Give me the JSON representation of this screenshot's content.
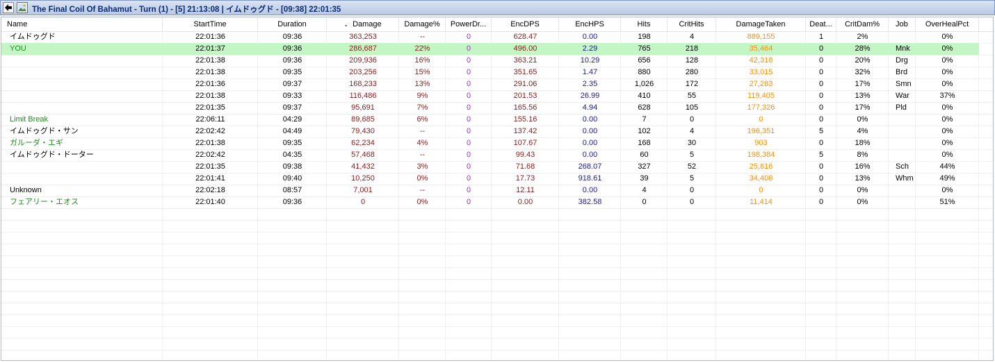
{
  "window": {
    "title": "The Final Coil Of Bahamut - Turn (1) - [5] 21:13:08 | イムドゥグド - [09:38] 22:01:35"
  },
  "colors": {
    "damage": "#8b1a1a",
    "damage_pct": "#8b1a1a",
    "power": "#9932cc",
    "encdps": "#8b1a1a",
    "enchps": "#1a1a8b",
    "damage_taken": "#ff8c00",
    "highlight_row": "#c4f5c4",
    "name_green": "#228b22",
    "name_default": "#000000"
  },
  "table": {
    "sort_indicator": "⌄",
    "columns": [
      "Name",
      "StartTime",
      "Duration",
      "Damage",
      "Damage%",
      "PowerDr...",
      "EncDPS",
      "EncHPS",
      "Hits",
      "CritHits",
      "DamageTaken",
      "Deat...",
      "CritDam%",
      "Job",
      "OverHealPct"
    ],
    "rows": [
      {
        "name": "イムドゥグド",
        "name_color": "black",
        "highlight": false,
        "start": "22:01:36",
        "duration": "09:36",
        "damage": "363,253",
        "damage_pct": "--",
        "power": "0",
        "encdps": "628.47",
        "enchps": "0.00",
        "hits": "198",
        "crit": "4",
        "taken": "889,155",
        "deaths": "1",
        "critdam": "2%",
        "job": "",
        "overheal": "0%"
      },
      {
        "name": "YOU",
        "name_color": "green",
        "highlight": true,
        "start": "22:01:37",
        "duration": "09:36",
        "damage": "286,687",
        "damage_pct": "22%",
        "power": "0",
        "encdps": "496.00",
        "enchps": "2.29",
        "hits": "765",
        "crit": "218",
        "taken": "35,464",
        "deaths": "0",
        "critdam": "28%",
        "job": "Mnk",
        "overheal": "0%"
      },
      {
        "name": "",
        "name_color": "black",
        "highlight": false,
        "start": "22:01:38",
        "duration": "09:36",
        "damage": "209,936",
        "damage_pct": "16%",
        "power": "0",
        "encdps": "363.21",
        "enchps": "10.29",
        "hits": "656",
        "crit": "128",
        "taken": "42,318",
        "deaths": "0",
        "critdam": "20%",
        "job": "Drg",
        "overheal": "0%"
      },
      {
        "name": "",
        "name_color": "black",
        "highlight": false,
        "start": "22:01:38",
        "duration": "09:35",
        "damage": "203,256",
        "damage_pct": "15%",
        "power": "0",
        "encdps": "351.65",
        "enchps": "1.47",
        "hits": "880",
        "crit": "280",
        "taken": "33,015",
        "deaths": "0",
        "critdam": "32%",
        "job": "Brd",
        "overheal": "0%"
      },
      {
        "name": "",
        "name_color": "black",
        "highlight": false,
        "start": "22:01:36",
        "duration": "09:37",
        "damage": "168,233",
        "damage_pct": "13%",
        "power": "0",
        "encdps": "291.06",
        "enchps": "2.35",
        "hits": "1,026",
        "crit": "172",
        "taken": "27,283",
        "deaths": "0",
        "critdam": "17%",
        "job": "Smn",
        "overheal": "0%"
      },
      {
        "name": "",
        "name_color": "black",
        "highlight": false,
        "start": "22:01:38",
        "duration": "09:33",
        "damage": "116,486",
        "damage_pct": "9%",
        "power": "0",
        "encdps": "201.53",
        "enchps": "26.99",
        "hits": "410",
        "crit": "55",
        "taken": "119,405",
        "deaths": "0",
        "critdam": "13%",
        "job": "War",
        "overheal": "37%"
      },
      {
        "name": "",
        "name_color": "black",
        "highlight": false,
        "start": "22:01:35",
        "duration": "09:37",
        "damage": "95,691",
        "damage_pct": "7%",
        "power": "0",
        "encdps": "165.56",
        "enchps": "4.94",
        "hits": "628",
        "crit": "105",
        "taken": "177,326",
        "deaths": "0",
        "critdam": "17%",
        "job": "Pld",
        "overheal": "0%"
      },
      {
        "name": "Limit Break",
        "name_color": "green",
        "highlight": false,
        "start": "22:06:11",
        "duration": "04:29",
        "damage": "89,685",
        "damage_pct": "6%",
        "power": "0",
        "encdps": "155.16",
        "enchps": "0.00",
        "hits": "7",
        "crit": "0",
        "taken": "0",
        "deaths": "0",
        "critdam": "0%",
        "job": "",
        "overheal": "0%"
      },
      {
        "name": "イムドゥグド・サン",
        "name_color": "black",
        "highlight": false,
        "start": "22:02:42",
        "duration": "04:49",
        "damage": "79,430",
        "damage_pct": "--",
        "power": "0",
        "encdps": "137.42",
        "enchps": "0.00",
        "hits": "102",
        "crit": "4",
        "taken": "196,351",
        "deaths": "5",
        "critdam": "4%",
        "job": "",
        "overheal": "0%"
      },
      {
        "name": "ガルーダ・エギ",
        "name_color": "green",
        "highlight": false,
        "start": "22:01:38",
        "duration": "09:35",
        "damage": "62,234",
        "damage_pct": "4%",
        "power": "0",
        "encdps": "107.67",
        "enchps": "0.00",
        "hits": "168",
        "crit": "30",
        "taken": "903",
        "deaths": "0",
        "critdam": "18%",
        "job": "",
        "overheal": "0%"
      },
      {
        "name": "イムドゥグド・ドーター",
        "name_color": "black",
        "highlight": false,
        "start": "22:02:42",
        "duration": "04:35",
        "damage": "57,468",
        "damage_pct": "--",
        "power": "0",
        "encdps": "99.43",
        "enchps": "0.00",
        "hits": "60",
        "crit": "5",
        "taken": "198,384",
        "deaths": "5",
        "critdam": "8%",
        "job": "",
        "overheal": "0%"
      },
      {
        "name": "",
        "name_color": "black",
        "highlight": false,
        "start": "22:01:35",
        "duration": "09:38",
        "damage": "41,432",
        "damage_pct": "3%",
        "power": "0",
        "encdps": "71.68",
        "enchps": "268.07",
        "hits": "327",
        "crit": "52",
        "taken": "25,616",
        "deaths": "0",
        "critdam": "16%",
        "job": "Sch",
        "overheal": "44%"
      },
      {
        "name": "",
        "name_color": "black",
        "highlight": false,
        "start": "22:01:41",
        "duration": "09:40",
        "damage": "10,250",
        "damage_pct": "0%",
        "power": "0",
        "encdps": "17.73",
        "enchps": "918.61",
        "hits": "39",
        "crit": "5",
        "taken": "34,408",
        "deaths": "0",
        "critdam": "13%",
        "job": "Whm",
        "overheal": "49%"
      },
      {
        "name": "Unknown",
        "name_color": "black",
        "highlight": false,
        "start": "22:02:18",
        "duration": "08:57",
        "damage": "7,001",
        "damage_pct": "--",
        "power": "0",
        "encdps": "12.11",
        "enchps": "0.00",
        "hits": "4",
        "crit": "0",
        "taken": "0",
        "deaths": "0",
        "critdam": "0%",
        "job": "",
        "overheal": "0%"
      },
      {
        "name": "フェアリー・エオス",
        "name_color": "green",
        "highlight": false,
        "start": "22:01:40",
        "duration": "09:36",
        "damage": "0",
        "damage_pct": "0%",
        "power": "0",
        "encdps": "0.00",
        "enchps": "382.58",
        "hits": "0",
        "crit": "0",
        "taken": "11,414",
        "deaths": "0",
        "critdam": "0%",
        "job": "",
        "overheal": "51%"
      }
    ]
  }
}
